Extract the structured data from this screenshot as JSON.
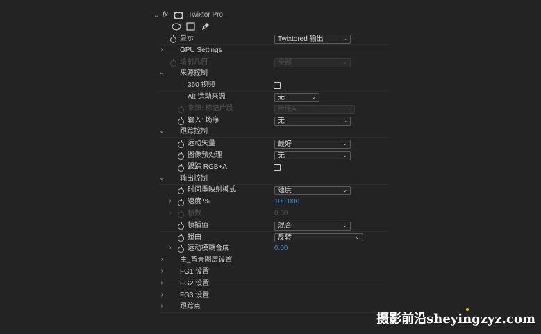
{
  "effect": {
    "fx_label": "fx",
    "name": "Twixtor Pro",
    "mask_tools": [
      "ellipse-mask-icon",
      "rectangle-mask-icon",
      "pen-mask-icon"
    ]
  },
  "rows": {
    "display": {
      "label": "显示",
      "value": "Twixtored 输出"
    },
    "gpu": {
      "label": "GPU Settings"
    },
    "draw_geometry": {
      "label": "绘制几何",
      "value": "全部"
    },
    "source_control": {
      "label": "来源控制"
    },
    "video360": {
      "label": "360 视频"
    },
    "alt_motion": {
      "label": "Alt 运动来源",
      "value": "无"
    },
    "source_clip": {
      "label": "来源: 标记片段",
      "value": "片段A"
    },
    "input_field": {
      "label": "输入: 场序",
      "value": "无"
    },
    "tracking_control": {
      "label": "跟踪控制"
    },
    "motion_vectors": {
      "label": "运动矢量",
      "value": "最好"
    },
    "image_prep": {
      "label": "图像预处理",
      "value": "无"
    },
    "track_rgba": {
      "label": "跟踪 RGB+A"
    },
    "output_control": {
      "label": "输出控制"
    },
    "time_remap": {
      "label": "时间重映射模式",
      "value": "速度"
    },
    "speed": {
      "label": "速度 %",
      "value": "100.000"
    },
    "frames": {
      "label": "帧数",
      "value": "0.00"
    },
    "frame_interp": {
      "label": "帧插值",
      "value": "混合"
    },
    "warping": {
      "label": "扭曲",
      "value": "反转"
    },
    "motion_blur": {
      "label": "运动模糊合成",
      "value": "0.00"
    },
    "main_bg": {
      "label": "主_背景图层设置"
    },
    "fg1": {
      "label": "FG1 设置"
    },
    "fg2": {
      "label": "FG2 设置"
    },
    "fg3": {
      "label": "FG3 设置"
    },
    "track_points": {
      "label": "跟踪点"
    }
  },
  "watermark": "摄影前沿sheyingzyz.com",
  "colors": {
    "background": "#232323",
    "value_blue": "#3f8de0",
    "text": "#cfcfcf",
    "dimmed": "#575757"
  }
}
